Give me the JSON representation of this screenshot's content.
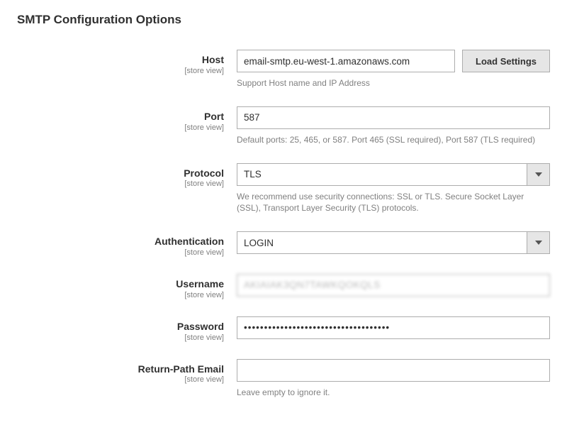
{
  "section_title": "SMTP Configuration Options",
  "scope_label": "[store view]",
  "fields": {
    "host": {
      "label": "Host",
      "value": "email-smtp.eu-west-1.amazonaws.com",
      "button": "Load Settings",
      "help": "Support Host name and IP Address"
    },
    "port": {
      "label": "Port",
      "value": "587",
      "help": "Default ports: 25, 465, or 587. Port 465 (SSL required), Port 587 (TLS required)"
    },
    "protocol": {
      "label": "Protocol",
      "value": "TLS",
      "help": "We recommend use security connections: SSL or TLS. Secure Socket Layer (SSL), Transport Layer Security (TLS) protocols."
    },
    "auth": {
      "label": "Authentication",
      "value": "LOGIN"
    },
    "username": {
      "label": "Username",
      "value": "AKIAIAK3QN7TAWKQOKQLS"
    },
    "password": {
      "label": "Password",
      "value": "••••••••••••••••••••••••••••••••••••"
    },
    "return_path": {
      "label": "Return-Path Email",
      "value": "",
      "help": "Leave empty to ignore it."
    }
  }
}
